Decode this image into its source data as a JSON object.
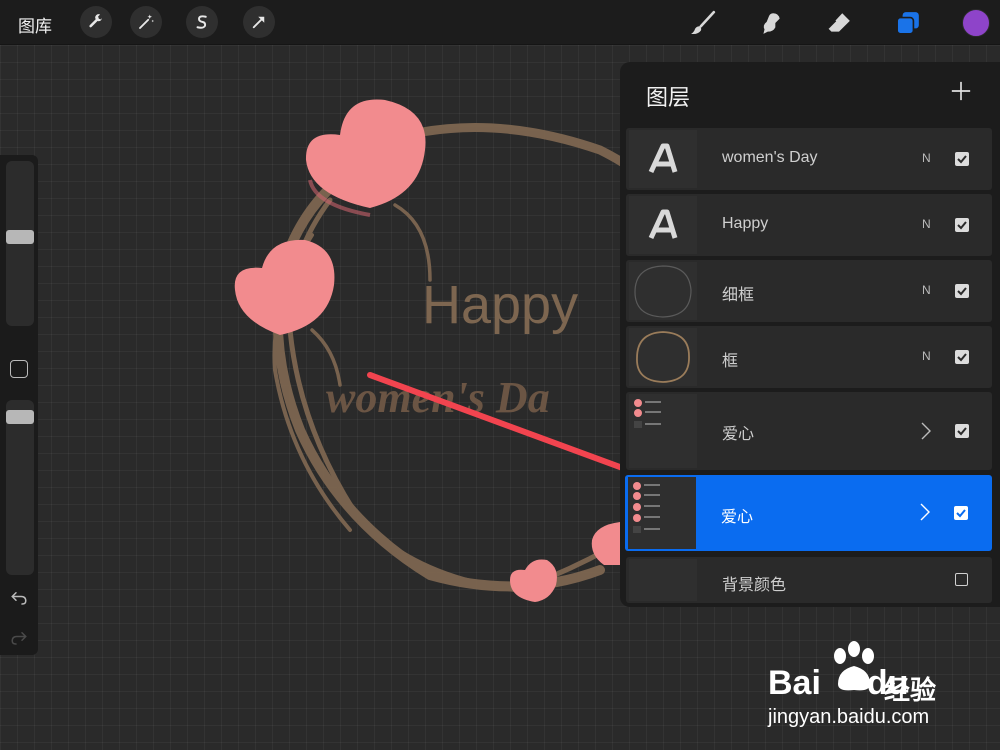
{
  "toolbar": {
    "gallery_label": "图库",
    "left_tools": [
      "wrench-icon",
      "magic-wand-icon",
      "selection-s-icon",
      "move-arrow-icon"
    ],
    "right_tools": [
      "brush-icon",
      "smudge-icon",
      "eraser-icon",
      "layers-icon"
    ],
    "color_swatch": "#8e44c9",
    "accent": "#0a6cf0"
  },
  "canvas": {
    "text_happy": "Happy",
    "text_womens_day": "women's Da",
    "text_color": "#7d6650",
    "heart_color": "#f28b8e"
  },
  "layers_panel": {
    "title": "图层",
    "layers": [
      {
        "name": "women's Day",
        "blend": "N",
        "type": "text",
        "visible": true
      },
      {
        "name": "Happy",
        "blend": "N",
        "type": "text",
        "visible": true
      },
      {
        "name": "细框",
        "blend": "N",
        "type": "frame",
        "visible": true
      },
      {
        "name": "框",
        "blend": "N",
        "type": "frame",
        "visible": true
      },
      {
        "name": "爱心",
        "blend": "",
        "type": "group",
        "visible": true
      },
      {
        "name": "爱心",
        "blend": "",
        "type": "group",
        "visible": true,
        "selected": true
      },
      {
        "name": "背景颜色",
        "blend": "",
        "type": "background",
        "visible": false
      }
    ]
  },
  "watermark": {
    "brand_bai": "Bai",
    "brand_du": "du",
    "brand_jingyan": "经验",
    "url": "jingyan.baidu.com"
  }
}
